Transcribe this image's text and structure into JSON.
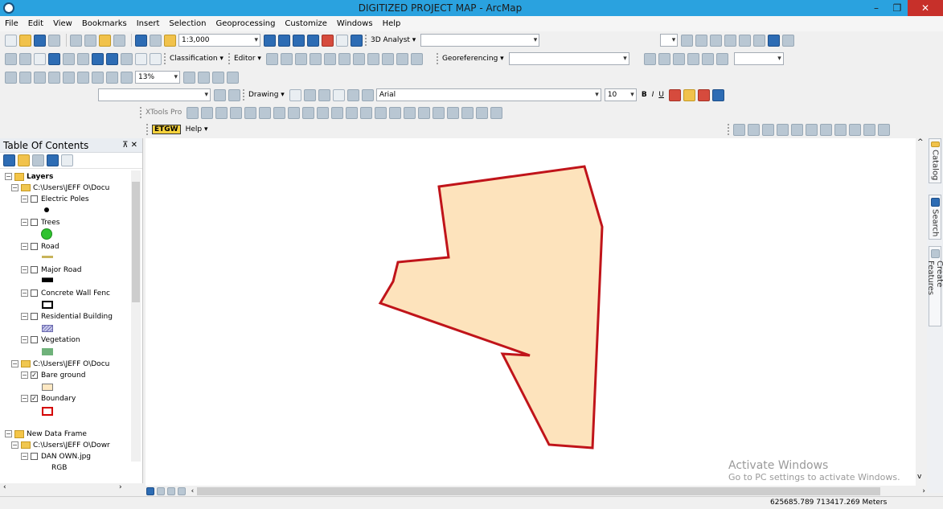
{
  "window": {
    "title": "DIGITIZED PROJECT MAP - ArcMap",
    "minimize_glyph": "–",
    "maximize_glyph": "❐",
    "close_glyph": "✕"
  },
  "menu": [
    "File",
    "Edit",
    "View",
    "Bookmarks",
    "Insert",
    "Selection",
    "Geoprocessing",
    "Customize",
    "Windows",
    "Help"
  ],
  "toolbars": {
    "scale": "1:3,000",
    "analyst_3d": "3D Analyst ▾",
    "classification": "Classification ▾",
    "editor": "Editor ▾",
    "georeferencing": "Georeferencing ▾",
    "zoom_percent": "13%",
    "drawing": "Drawing ▾",
    "font_name": "Arial",
    "font_size": "10",
    "bold": "B",
    "italic": "I",
    "underline": "U",
    "xtools": "XTools Pro",
    "etgw": "ETGW",
    "help": "Help ▾"
  },
  "toc": {
    "title": "Table Of Contents",
    "pin_glyph": "⊼ ✕",
    "items": [
      {
        "label": "Layers"
      },
      {
        "label": "C:\\Users\\JEFF O\\Docu"
      },
      {
        "label": "Electric Poles"
      },
      {
        "label": "Trees"
      },
      {
        "label": "Road"
      },
      {
        "label": "Major Road"
      },
      {
        "label": "Concrete Wall Fenc"
      },
      {
        "label": "Residential Building"
      },
      {
        "label": "Vegetation"
      },
      {
        "label": "C:\\Users\\JEFF O\\Docu"
      },
      {
        "label": "Bare ground"
      },
      {
        "label": "Boundary"
      },
      {
        "label": "New Data Frame"
      },
      {
        "label": "C:\\Users\\JEFF O\\Dowr"
      },
      {
        "label": "DAN OWN.jpg"
      },
      {
        "label": "RGB"
      }
    ],
    "colors": {
      "tree_symbol": "#2fc22f",
      "road_symbol": "#c8b45a",
      "vegetation_symbol": "#6fb27a",
      "bare_ground_fill": "#fde8c3",
      "boundary_outline": "#d40000"
    }
  },
  "map": {
    "polygon_fill": "#fde3bc",
    "polygon_outline": "#c0141a"
  },
  "docks": {
    "catalog": "Catalog",
    "search": "Search",
    "create_features": "Create Features"
  },
  "watermark": {
    "line1": "Activate Windows",
    "line2": "Go to PC settings to activate Windows."
  },
  "status": {
    "coords": "625685.789  713417.269 Meters"
  }
}
